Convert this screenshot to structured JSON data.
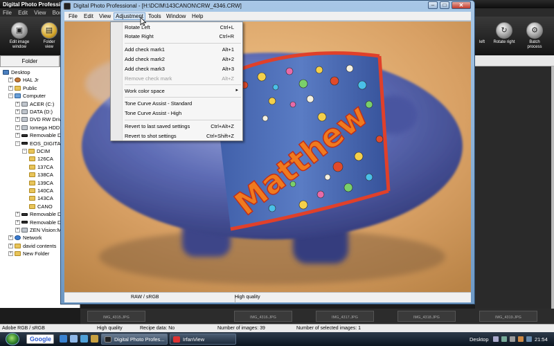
{
  "bg_app": {
    "title": "Digital Photo Professional",
    "menu": [
      "File",
      "Edit",
      "View",
      "Book"
    ],
    "toolbar": [
      {
        "label_1": "Edit image",
        "label_2": "window",
        "icon": "edit-image-icon"
      },
      {
        "label_1": "Folder",
        "label_2": "view",
        "icon": "folder-view-icon"
      },
      {
        "label_1": "left",
        "label_2": "",
        "icon": "rotate-left-icon"
      },
      {
        "label_1": "Rotate right",
        "label_2": "",
        "icon": "rotate-right-icon"
      },
      {
        "label_1": "Batch",
        "label_2": "process",
        "icon": "batch-process-icon"
      }
    ],
    "folder_tab": "Folder",
    "tree": [
      {
        "label": "Desktop",
        "icon": "desk"
      },
      {
        "label": "HAL Jr",
        "icon": "hal"
      },
      {
        "label": "Public",
        "icon": "folder"
      },
      {
        "label": "Computer",
        "icon": "comp"
      },
      {
        "label": "ACER (C:)",
        "icon": "drive"
      },
      {
        "label": "DATA (D:)",
        "icon": "drive"
      },
      {
        "label": "DVD RW Drive",
        "icon": "drive"
      },
      {
        "label": "Iomega HDD (",
        "icon": "drive"
      },
      {
        "label": "Removable Di",
        "icon": "dark"
      },
      {
        "label": "EOS_DIGITAL (",
        "icon": "dark"
      },
      {
        "label": "DCIM",
        "icon": "folder"
      },
      {
        "label": "126CA",
        "icon": "folder"
      },
      {
        "label": "137CA",
        "icon": "folder"
      },
      {
        "label": "138CA",
        "icon": "folder"
      },
      {
        "label": "139CA",
        "icon": "folder"
      },
      {
        "label": "140CA",
        "icon": "folder"
      },
      {
        "label": "143CA",
        "icon": "folder"
      },
      {
        "label": "CANO",
        "icon": "folder"
      },
      {
        "label": "Removable Di",
        "icon": "dark"
      },
      {
        "label": "Removable Di",
        "icon": "dark"
      },
      {
        "label": "ZEN Vision:M",
        "icon": "drive"
      },
      {
        "label": "Network",
        "icon": "net"
      },
      {
        "label": "david contents",
        "icon": "folder"
      },
      {
        "label": "New Folder",
        "icon": "folder"
      }
    ],
    "thumbs": [
      "",
      "IMG_4316.JPG",
      "IMG_4317.JPG",
      "IMG_4318.JPG",
      "IMG_4319.JPG"
    ],
    "thumb_first": "IMG_4315.JPG",
    "status": {
      "color_space": "Adobe RGB / sRGB",
      "quality": "High quality",
      "recipe": "Recipe data: No",
      "num_images": "Number of images: 39",
      "num_selected": "Number of selected images: 1"
    }
  },
  "taskbar": {
    "google": "Google",
    "tasks": [
      {
        "label": "Digital Photo Profes...",
        "active": true
      },
      {
        "label": "IrfanView",
        "active": false
      }
    ],
    "desktop_label": "Desktop",
    "clock": "21:54"
  },
  "window": {
    "title": "Digital Photo Professional - [H:\\DCIM\\143CANON\\CRW_4346.CRW]",
    "menu": [
      "File",
      "Edit",
      "View",
      "Adjustment",
      "Tools",
      "Window",
      "Help"
    ],
    "open_menu": "Adjustment",
    "status": {
      "mode": "RAW / sRGB",
      "quality": "High quality"
    },
    "photo_text": "Matthew"
  },
  "dropdown": {
    "items": [
      {
        "label": "Rotate Left",
        "shortcut": "Ctrl+L",
        "enabled": true
      },
      {
        "label": "Rotate Right",
        "shortcut": "Ctrl+R",
        "enabled": true
      },
      {
        "label": "Add check mark1",
        "shortcut": "Alt+1",
        "enabled": true
      },
      {
        "label": "Add check mark2",
        "shortcut": "Alt+2",
        "enabled": true
      },
      {
        "label": "Add check mark3",
        "shortcut": "Alt+3",
        "enabled": true
      },
      {
        "label": "Remove check mark",
        "shortcut": "Alt+Z",
        "enabled": false
      },
      {
        "label": "Work color space",
        "shortcut": "",
        "enabled": true,
        "submenu": true
      },
      {
        "label": "Tone Curve Assist - Standard",
        "shortcut": "",
        "enabled": true
      },
      {
        "label": "Tone Curve Assist - High",
        "shortcut": "",
        "enabled": true
      },
      {
        "label": "Revert to last saved settings",
        "shortcut": "Ctrl+Alt+Z",
        "enabled": true
      },
      {
        "label": "Revert to shot settings",
        "shortcut": "Ctrl+Shift+Z",
        "enabled": true
      }
    ]
  }
}
